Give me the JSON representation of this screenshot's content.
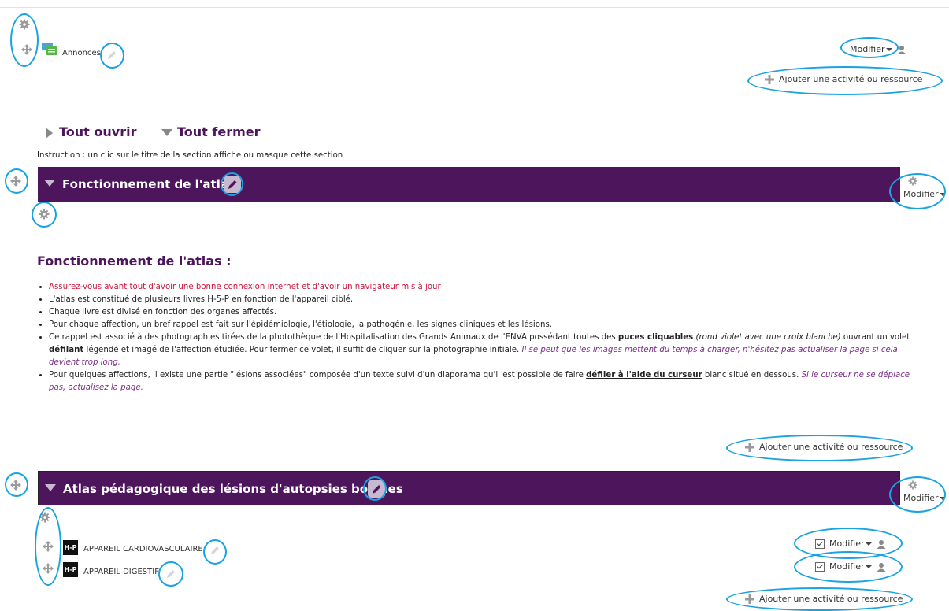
{
  "top": {
    "announce_label": "Annonces",
    "modifier": "Modifier",
    "add_activity": "Ajouter une activité ou ressource"
  },
  "toggles": {
    "open_all": "Tout ouvrir",
    "close_all": "Tout fermer",
    "instruction": "Instruction : un clic sur le titre de la section affiche ou masque cette section"
  },
  "section1": {
    "title": "Fonctionnement de l'atlas",
    "modifier": "Modifier",
    "heading": "Fonctionnement de l'atlas :",
    "bullets": {
      "b1": "Assurez-vous avant tout d'avoir une bonne connexion internet et d'avoir un navigateur mis à jour",
      "b2": "L'atlas est constitué de plusieurs livres H-5-P en fonction de l'appareil ciblé.",
      "b3": "Chaque livre est divisé en fonction des organes affectés.",
      "b4": "Pour chaque affection, un bref rappel est fait sur l'épidémiologie, l'étiologie, la pathogénie, les signes cliniques et les lésions.",
      "b5_part1": "Ce rappel est associé à des photographies tirées de la photothèque de l'Hospitalisation des Grands Animaux de l'ENVA possédant toutes des ",
      "b5_bold1": "puces cliquables",
      "b5_italic1": " (rond violet avec une croix blanche)",
      "b5_part2": " ouvrant un volet ",
      "b5_bold2": "défilant",
      "b5_part3": " légendé et imagé de l'affection étudiée. Pour fermer ce volet, il suffit de cliquer sur la photographie initiale. ",
      "b5_italic2": "Il se peut que les images mettent du temps à charger, n'hésitez pas actualiser la page si cela devient trop long.",
      "b6_part1": "Pour quelques affections, il existe une partie \"lésions associées\" composée d'un texte suivi d'un diaporama qu'il est possible de faire ",
      "b6_underline": "défiler à l'aide du curseur",
      "b6_part2": " blanc situé en dessous. ",
      "b6_italic": "Si le curseur ne se déplace pas, actualisez la page."
    },
    "add_activity": "Ajouter une activité ou ressource"
  },
  "section2": {
    "title": "Atlas pédagogique des lésions d'autopsies bovines",
    "modifier": "Modifier",
    "items": [
      {
        "badge": "H-P",
        "label": "APPAREIL CARDIOVASCULAIRE",
        "modifier": "Modifier"
      },
      {
        "badge": "H-P",
        "label": "APPAREIL DIGESTIF",
        "modifier": "Modifier"
      }
    ],
    "add_activity": "Ajouter une activité ou ressource"
  },
  "colors": {
    "section_bg": "#4d165c",
    "annotation_ring": "#1aa3e0",
    "warning_red": "#d0163b",
    "italic_purple": "#7a2d86"
  }
}
